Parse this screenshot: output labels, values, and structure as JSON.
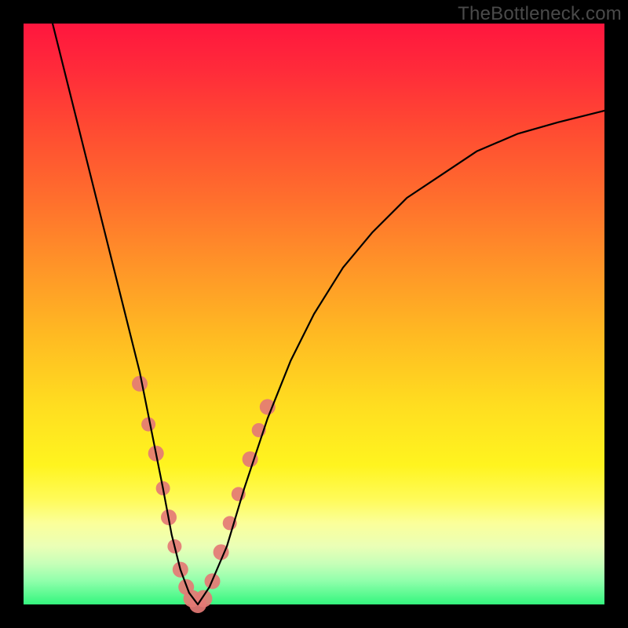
{
  "watermark": "TheBottleneck.com",
  "colors": {
    "frame": "#000000",
    "curve": "#000000",
    "dot": "#e47a75",
    "gradient_top": "#ff163e",
    "gradient_bottom": "#34f67e"
  },
  "chart_data": {
    "type": "line",
    "title": "",
    "xlabel": "",
    "ylabel": "",
    "xlim": [
      0,
      100
    ],
    "ylim": [
      0,
      100
    ],
    "annotations": [
      "TheBottleneck.com"
    ],
    "series": [
      {
        "name": "bottleneck-curve",
        "x": [
          5,
          8,
          11,
          14,
          17,
          20,
          22,
          24,
          25.5,
          27,
          28.5,
          30,
          32,
          35,
          38,
          42,
          46,
          50,
          55,
          60,
          66,
          72,
          78,
          85,
          92,
          100
        ],
        "y": [
          100,
          88,
          76,
          64,
          52,
          40,
          30,
          20,
          12,
          6,
          2,
          0,
          3,
          10,
          20,
          32,
          42,
          50,
          58,
          64,
          70,
          74,
          78,
          81,
          83,
          85
        ]
      }
    ],
    "scatter": [
      {
        "name": "marker-dots",
        "points": [
          {
            "x": 20.0,
            "y": 38,
            "r": 10
          },
          {
            "x": 21.5,
            "y": 31,
            "r": 9
          },
          {
            "x": 22.8,
            "y": 26,
            "r": 10
          },
          {
            "x": 24.0,
            "y": 20,
            "r": 9
          },
          {
            "x": 25.0,
            "y": 15,
            "r": 10
          },
          {
            "x": 26.0,
            "y": 10,
            "r": 9
          },
          {
            "x": 27.0,
            "y": 6,
            "r": 10
          },
          {
            "x": 28.0,
            "y": 3,
            "r": 10
          },
          {
            "x": 29.0,
            "y": 1,
            "r": 11
          },
          {
            "x": 30.0,
            "y": 0,
            "r": 11
          },
          {
            "x": 31.0,
            "y": 1,
            "r": 11
          },
          {
            "x": 32.5,
            "y": 4,
            "r": 10
          },
          {
            "x": 34.0,
            "y": 9,
            "r": 10
          },
          {
            "x": 35.5,
            "y": 14,
            "r": 9
          },
          {
            "x": 37.0,
            "y": 19,
            "r": 9
          },
          {
            "x": 39.0,
            "y": 25,
            "r": 10
          },
          {
            "x": 40.5,
            "y": 30,
            "r": 9
          },
          {
            "x": 42.0,
            "y": 34,
            "r": 10
          }
        ]
      }
    ]
  }
}
